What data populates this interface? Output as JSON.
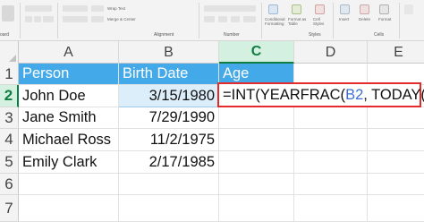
{
  "ribbon": {
    "groups": [
      {
        "label": "oard"
      },
      {
        "label": "Alignment"
      },
      {
        "label": "Number"
      },
      {
        "label": "Styles"
      },
      {
        "label": "Cells"
      }
    ],
    "wrap_text_label": "Wrap Text",
    "merge_center_label": "Merge & Center",
    "cond_format_label": "Conditional Formatting",
    "format_table_label": "Format as Table",
    "cell_styles_label": "Cell Styles",
    "insert_label": "Insert",
    "delete_label": "Delete",
    "format_label": "Format"
  },
  "columns": [
    {
      "label": "A",
      "active": false
    },
    {
      "label": "B",
      "active": false
    },
    {
      "label": "C",
      "active": true
    },
    {
      "label": "D",
      "active": false
    },
    {
      "label": "E",
      "active": false
    }
  ],
  "rows": [
    {
      "num": "1",
      "a": "Person",
      "b": "Birth Date",
      "c": "Age"
    },
    {
      "num": "2",
      "a": "John Doe",
      "b": "3/15/1980",
      "c": ""
    },
    {
      "num": "3",
      "a": "Jane Smith",
      "b": "7/29/1990",
      "c": ""
    },
    {
      "num": "4",
      "a": "Michael Ross",
      "b": "11/2/1975",
      "c": ""
    },
    {
      "num": "5",
      "a": "Emily Clark",
      "b": "2/17/1985",
      "c": ""
    },
    {
      "num": "6",
      "a": "",
      "b": "",
      "c": ""
    },
    {
      "num": "7",
      "a": "",
      "b": "",
      "c": ""
    }
  ],
  "formula": {
    "prefix": "=INT(YEARFRAC(",
    "ref": "B2",
    "middle": ", TODAY(",
    "close_inner": ")",
    "close_mid": ")",
    "close_outer": ")"
  },
  "colors": {
    "header_fill": "#44a9e8",
    "selection_green": "#107c41",
    "formula_border": "#e32b2b",
    "ref_blue": "#3b6fd4"
  }
}
